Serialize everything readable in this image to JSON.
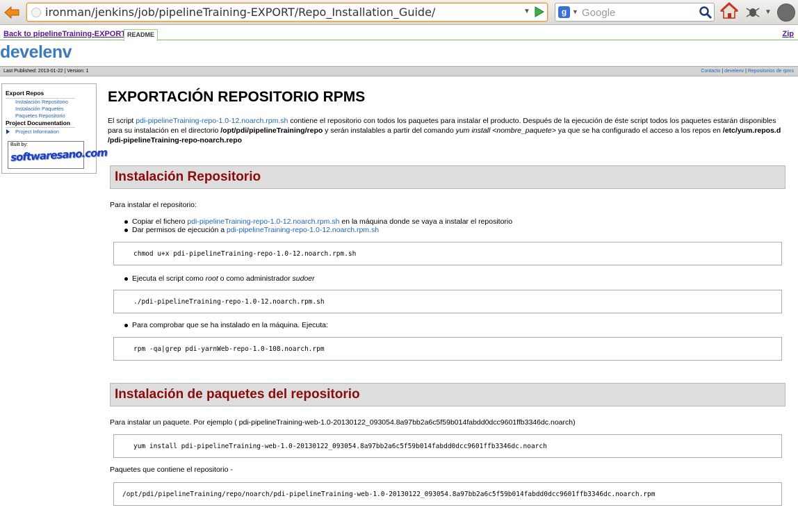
{
  "browser": {
    "url": "ironman/jenkins/job/pipelineTraining-EXPORT/Repo_Installation_Guide/",
    "search_placeholder": "Google",
    "search_engine_letter": "g"
  },
  "nav": {
    "back_link": "Back to pipelineTraining-EXPORT",
    "readme_tab": "README",
    "zip_link": "Zip"
  },
  "site_title": "develenv",
  "infobar": {
    "published": "Last Published: 2013-01-22",
    "separator": "|",
    "version": "Version: 1",
    "links": [
      "Contacto",
      "develenv",
      "Repositorios de rpms"
    ]
  },
  "leftnav": {
    "heading1": "Export Repos",
    "items1": [
      "Instalación Repositorio",
      "Instalación Paquetes",
      "Paquetes Repositorio"
    ],
    "heading2": "Project Documentation",
    "items2": [
      "Project Information"
    ],
    "builtby_label": "Built by:",
    "builtby_logo": "softwaresano.com"
  },
  "content": {
    "title": "EXPORTACIÓN REPOSITORIO RPMS",
    "intro_pre": "El script ",
    "intro_link": "pdi-pipelineTraining-repo-1.0-12.noarch.rpm.sh",
    "intro_mid1": " contiene el repositorio con todos los paquetes para instalar el producto. Después de la ejecución de éste script todos los paquetes estarán disponibles para su instalación en el directorio ",
    "intro_dir": "/opt/pdi/pipelineTraining/repo",
    "intro_mid2": " y serán instalables a partir del comando ",
    "intro_cmd": "yum install <nombre_paquete>",
    "intro_mid3": " ya que se ha configurado el acceso a los repos en ",
    "intro_repo": "/etc/yum.repos.d /pdi-pipelineTraining-repo-noarch.repo",
    "section1": {
      "heading": "Instalación Repositorio",
      "para": "Para instalar el repositorio:",
      "li1_pre": "Copiar el fichero ",
      "li1_link": "pdi-pipelineTraining-repo-1.0-12.noarch.rpm.sh",
      "li1_post": " en la máquina donde se vaya a instalar el repositorio",
      "li2_pre": "Dar permisos de ejecución a ",
      "li2_link": "pdi-pipelineTraining-repo-1.0-12.noarch.rpm.sh",
      "code1": "chmod u+x pdi-pipelineTraining-repo-1.0-12.noarch.rpm.sh",
      "li3_pre": "Ejecuta el script como ",
      "li3_root": "root",
      "li3_mid": " o como administrador ",
      "li3_sudoer": "sudoer",
      "code2": "./pdi-pipelineTraining-repo-1.0-12.noarch.rpm.sh",
      "li4": "Para comprobar que se ha instalado en la máquina. Ejecuta:",
      "code3": "rpm -qa|grep pdi-yarnWeb-repo-1.0-108.noarch.rpm"
    },
    "section2": {
      "heading": "Instalación de paquetes del repositorio",
      "para": "Para instalar un paquete. Por ejemplo ( pdi-pipelineTraining-web-1.0-20130122_093054.8a97bb2a6c5f59b014fabdd0dcc9601ffb3346dc.noarch)",
      "code1": "yum install pdi-pipelineTraining-web-1.0-20130122_093054.8a97bb2a6c5f59b014fabdd0dcc9601ffb3346dc.noarch",
      "para2": "Paquetes que contiene el repositorio -",
      "code2": "/opt/pdi/pipelineTraining/repo/noarch/pdi-pipelineTraining-web-1.0-20130122_093054.8a97bb2a6c5f59b014fabdd0dcc9601ffb3346dc.noarch.rpm"
    }
  },
  "colors": {
    "accent": "#3d7abd",
    "section_heading": "#8b0a0a",
    "link": "#2563b8",
    "visited_link": "#551a8b"
  }
}
